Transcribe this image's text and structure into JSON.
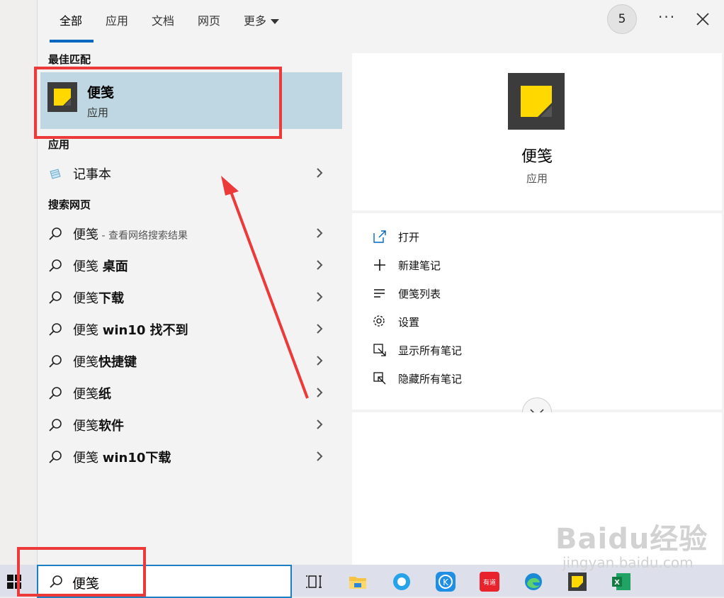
{
  "tabs": [
    {
      "label": "全部",
      "active": true
    },
    {
      "label": "应用"
    },
    {
      "label": "文档"
    },
    {
      "label": "网页"
    },
    {
      "label": "更多"
    }
  ],
  "account_badge": "5",
  "more_icon": "ellipsis-icon",
  "sections": {
    "best_match": "最佳匹配",
    "apps": "应用",
    "web": "搜索网页"
  },
  "best_match": {
    "name": "便笺",
    "type": "应用"
  },
  "apps": [
    {
      "name": "记事本"
    }
  ],
  "web_results": [
    {
      "prefix": "便笺",
      "bold": "",
      "suffix": " - 查看网络搜索结果"
    },
    {
      "prefix": "便笺 ",
      "bold": "桌面",
      "suffix": ""
    },
    {
      "prefix": "便笺",
      "bold": "下载",
      "suffix": ""
    },
    {
      "prefix": "便笺 ",
      "bold": "win10 找不到",
      "suffix": ""
    },
    {
      "prefix": "便笺",
      "bold": "快捷键",
      "suffix": ""
    },
    {
      "prefix": "便笺",
      "bold": "纸",
      "suffix": ""
    },
    {
      "prefix": "便笺",
      "bold": "软件",
      "suffix": ""
    },
    {
      "prefix": "便笺 ",
      "bold": "win10下载",
      "suffix": ""
    }
  ],
  "preview": {
    "name": "便笺",
    "type": "应用"
  },
  "actions": [
    {
      "label": "打开",
      "icon": "open-icon"
    },
    {
      "label": "新建笔记",
      "icon": "plus-icon"
    },
    {
      "label": "便笺列表",
      "icon": "list-icon"
    },
    {
      "label": "设置",
      "icon": "gear-icon"
    },
    {
      "label": "显示所有笔记",
      "icon": "show-notes-icon"
    },
    {
      "label": "隐藏所有笔记",
      "icon": "hide-notes-icon"
    }
  ],
  "search": {
    "query": "便笺"
  },
  "taskbar": [
    "task-view-icon",
    "file-explorer-icon",
    "qq-browser-icon",
    "kugou-icon",
    "youdao-icon",
    "edge-icon",
    "sticky-notes-icon",
    "excel-icon"
  ],
  "taskbar_youdao_text": "有道",
  "watermark": {
    "line1": "Baidu经验",
    "line2": "jingyan.baidu.com"
  },
  "colors": {
    "accent": "#0067c0",
    "selection": "#bed7e2",
    "annotation": "#ec3a3a",
    "sticky_yellow": "#ffd800"
  }
}
